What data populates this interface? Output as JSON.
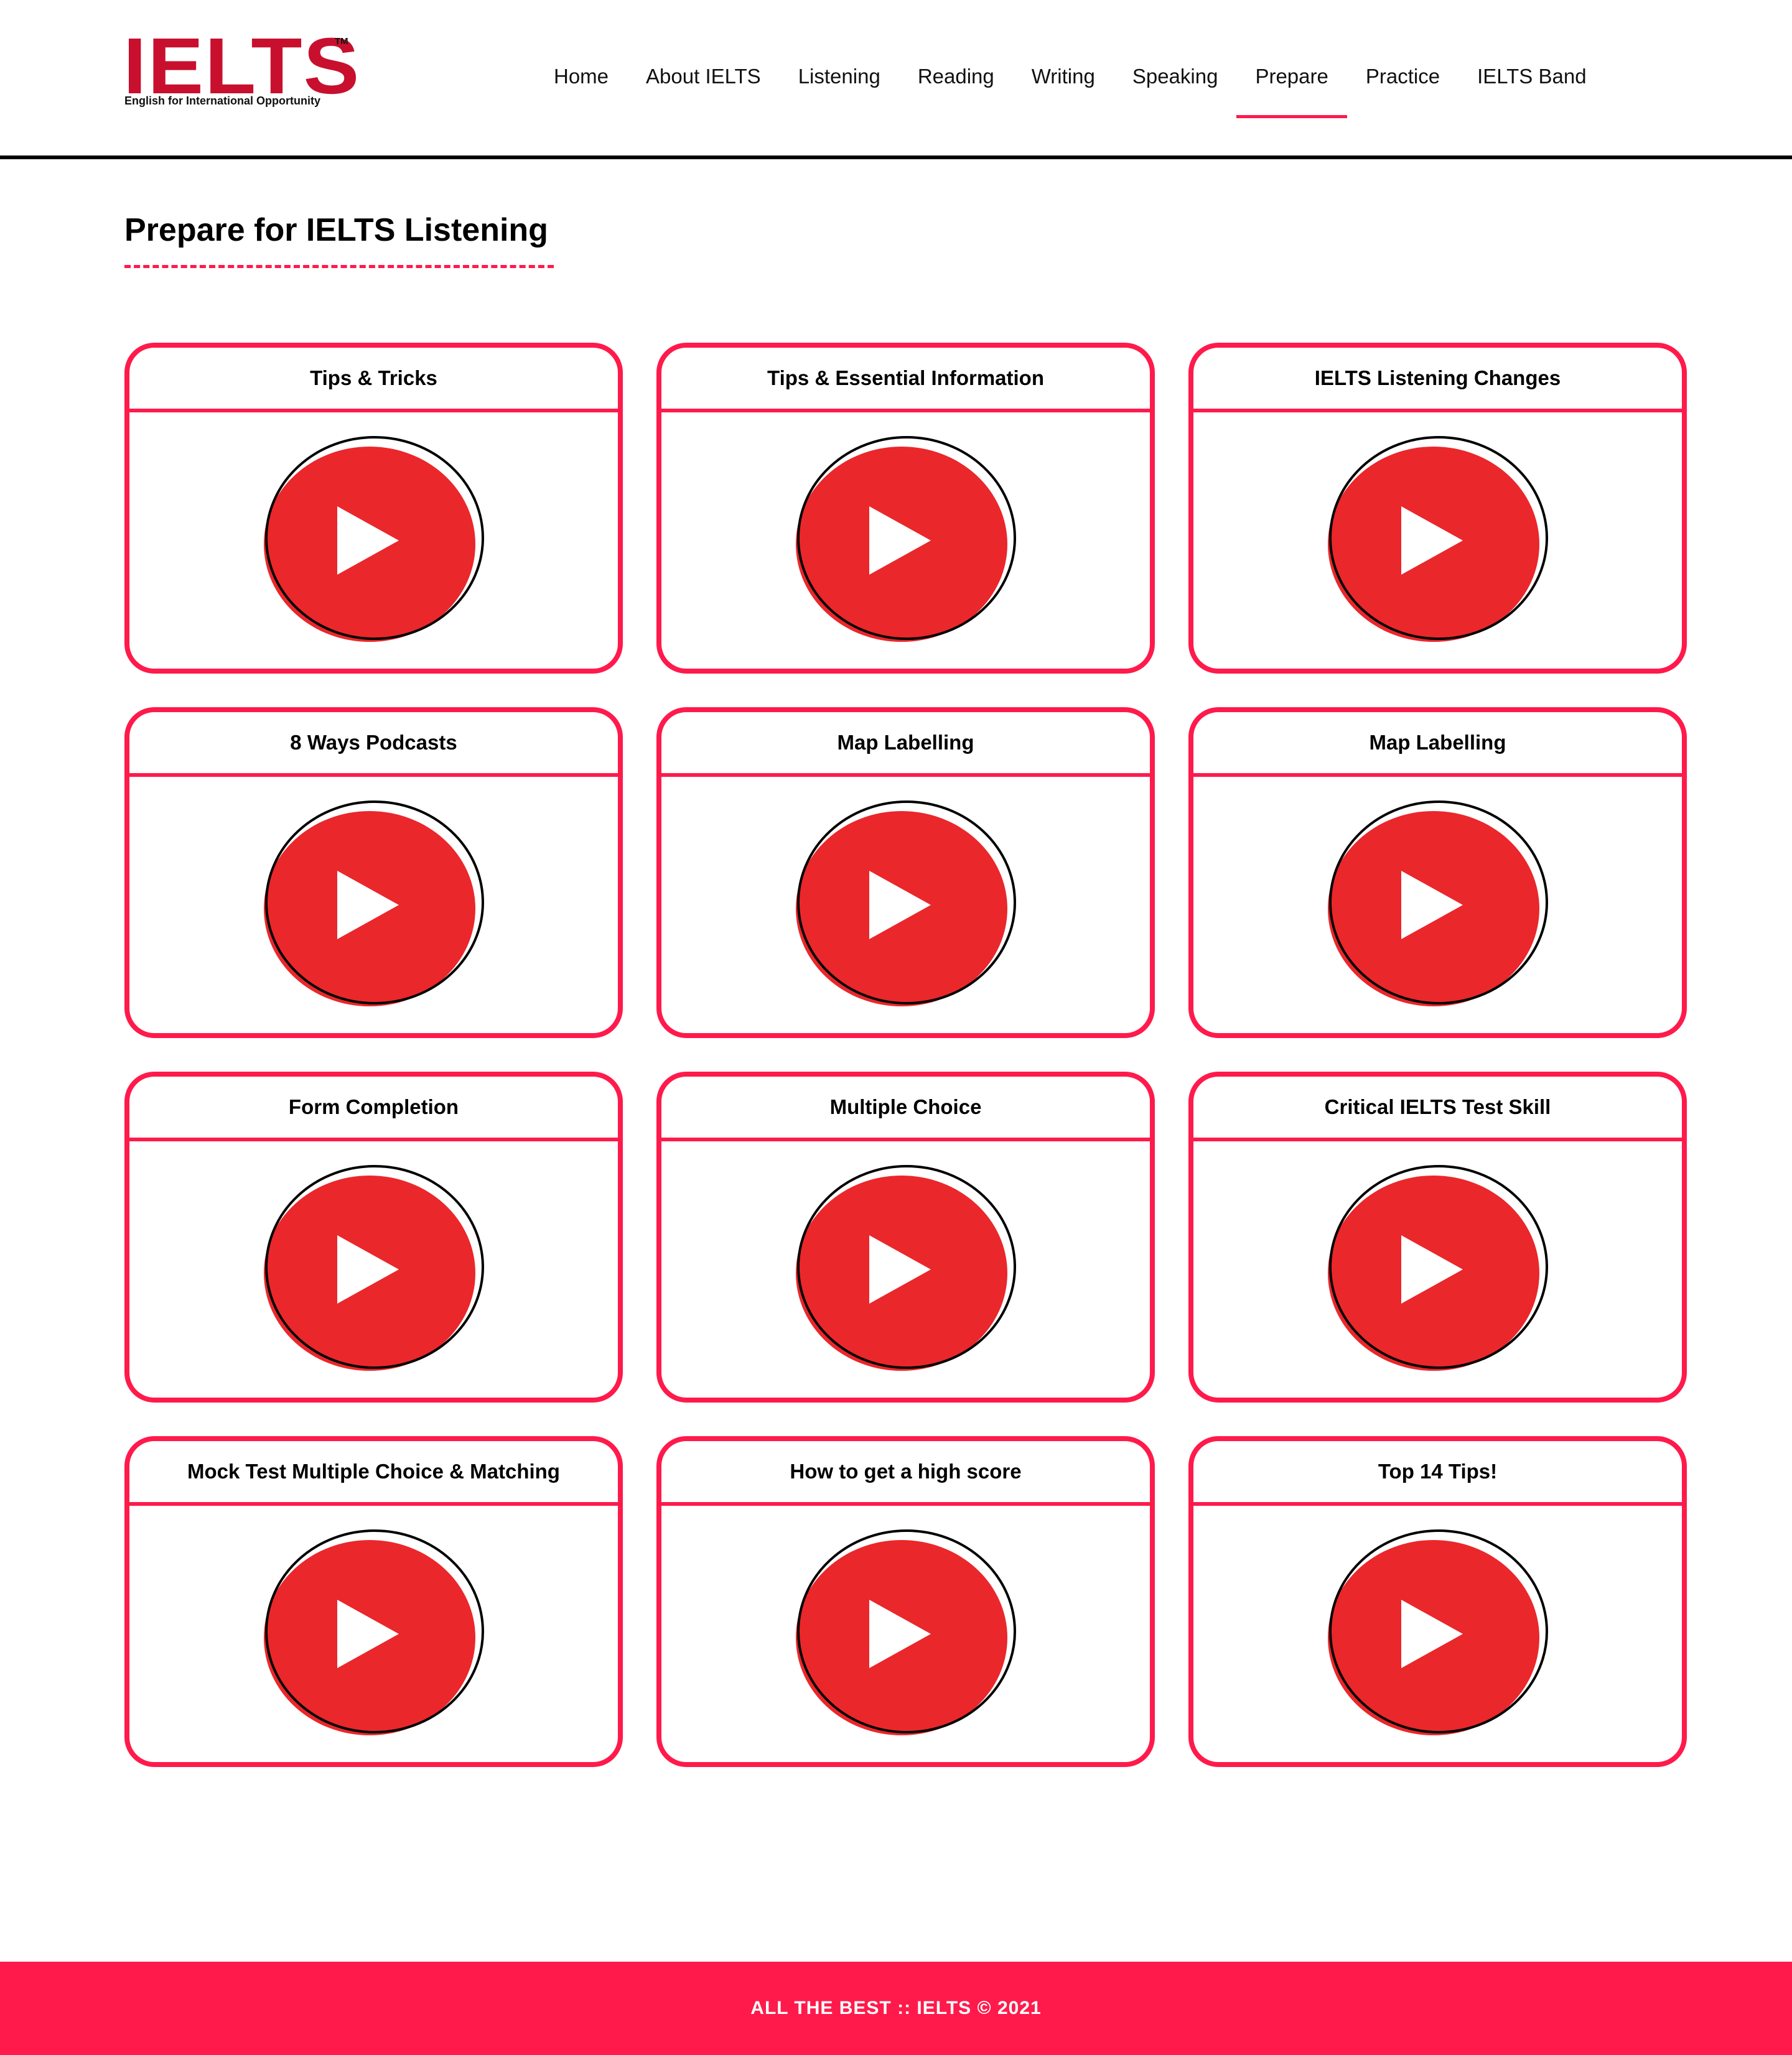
{
  "logo": {
    "wordmark": "IELTS",
    "trademark": "TM",
    "tagline": "English for International Opportunity"
  },
  "nav": {
    "items": [
      {
        "label": "Home",
        "active": false
      },
      {
        "label": "About IELTS",
        "active": false
      },
      {
        "label": "Listening",
        "active": false
      },
      {
        "label": "Reading",
        "active": false
      },
      {
        "label": "Writing",
        "active": false
      },
      {
        "label": "Speaking",
        "active": false
      },
      {
        "label": "Prepare",
        "active": true
      },
      {
        "label": "Practice",
        "active": false
      },
      {
        "label": "IELTS Band",
        "active": false
      }
    ]
  },
  "page": {
    "title": "Prepare for IELTS Listening"
  },
  "videos": [
    {
      "title": "Tips & Tricks",
      "icon": "play-icon"
    },
    {
      "title": "Tips & Essential Information",
      "icon": "play-icon"
    },
    {
      "title": "IELTS Listening Changes",
      "icon": "play-icon"
    },
    {
      "title": "8 Ways Podcasts",
      "icon": "play-icon"
    },
    {
      "title": "Map Labelling",
      "icon": "play-icon"
    },
    {
      "title": "Map Labelling",
      "icon": "play-icon"
    },
    {
      "title": "Form Completion",
      "icon": "play-icon"
    },
    {
      "title": "Multiple Choice",
      "icon": "play-icon"
    },
    {
      "title": "Critical IELTS Test Skill",
      "icon": "play-icon"
    },
    {
      "title": "Mock Test Multiple Choice & Matching",
      "icon": "play-icon"
    },
    {
      "title": "How to get a high score",
      "icon": "play-icon"
    },
    {
      "title": "Top 14 Tips!",
      "icon": "play-icon"
    }
  ],
  "footer": {
    "text": "ALL THE BEST :: IELTS © 2021"
  },
  "colors": {
    "accent": "#ff1a4b",
    "brand": "#c8102e",
    "play_fill": "#ea272b",
    "play_outline": "#000000"
  }
}
